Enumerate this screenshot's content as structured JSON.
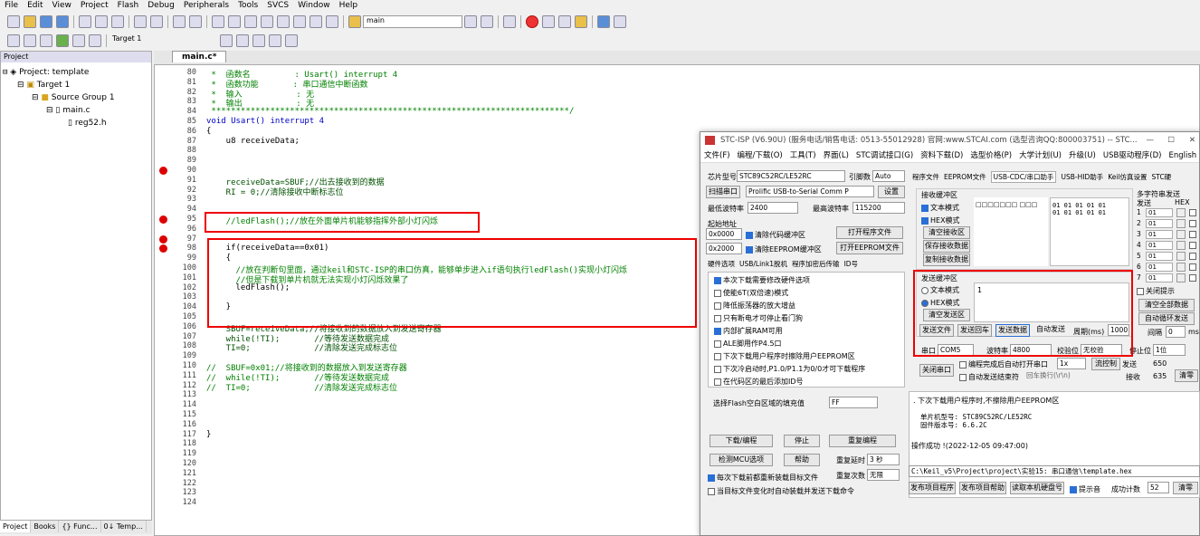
{
  "menu": [
    "File",
    "Edit",
    "View",
    "Project",
    "Flash",
    "Debug",
    "Peripherals",
    "Tools",
    "SVCS",
    "Window",
    "Help"
  ],
  "toolbar": {
    "target_search": "main",
    "target": "Target 1"
  },
  "project": {
    "header": "Project",
    "root": "Project: template",
    "target": "Target 1",
    "group": "Source Group 1",
    "file1": "main.c",
    "file2": "reg52.h",
    "tabs": [
      "Project",
      "Books",
      "{} Func...",
      "0↓ Temp..."
    ]
  },
  "editor": {
    "tab": "main.c*"
  },
  "code_lines": [
    {
      "n": "80",
      "t": " *  函数名         : Usart() interrupt 4",
      "c": "cm"
    },
    {
      "n": "81",
      "t": " *  函数功能       : 串口通信中断函数",
      "c": "cm"
    },
    {
      "n": "82",
      "t": " *  输入           : 无",
      "c": "cm"
    },
    {
      "n": "83",
      "t": " *  输出           : 无",
      "c": "cm"
    },
    {
      "n": "84",
      "t": " *************************************************************************/",
      "c": "cm"
    },
    {
      "n": "85",
      "t": "void Usart() interrupt 4",
      "c": "kw"
    },
    {
      "n": "86",
      "t": "{",
      "c": ""
    },
    {
      "n": "87",
      "t": "    u8 receiveData;",
      "c": ""
    },
    {
      "n": "88",
      "t": "",
      "c": ""
    },
    {
      "n": "89",
      "t": "",
      "c": ""
    },
    {
      "n": "90",
      "t": "",
      "c": ""
    },
    {
      "n": "91",
      "t": "    receiveData=SBUF;//出去接收到的数据",
      "c": "mix"
    },
    {
      "n": "92",
      "t": "    RI = 0;//清除接收中断标志位",
      "c": "mix"
    },
    {
      "n": "93",
      "t": "",
      "c": ""
    },
    {
      "n": "94",
      "t": "",
      "c": ""
    },
    {
      "n": "95",
      "t": "    //ledFlash();//放在外面单片机能够指挥外部小灯闪烁",
      "c": "cm"
    },
    {
      "n": "96",
      "t": "",
      "c": ""
    },
    {
      "n": "97",
      "t": "",
      "c": ""
    },
    {
      "n": "98",
      "t": "    if(receiveData==0x01)",
      "c": ""
    },
    {
      "n": "99",
      "t": "    {",
      "c": ""
    },
    {
      "n": "100",
      "t": "      //放在判断句里面，通过keil和STC-ISP的串口仿真，能够单步进入if语句执行ledFlash()实现小灯闪烁",
      "c": "cm"
    },
    {
      "n": "101",
      "t": "      //但是下载到单片机就无法实现小灯闪烁效果了",
      "c": "cm"
    },
    {
      "n": "102",
      "t": "      ledFlash();",
      "c": ""
    },
    {
      "n": "103",
      "t": "",
      "c": ""
    },
    {
      "n": "104",
      "t": "    }",
      "c": ""
    },
    {
      "n": "105",
      "t": "",
      "c": ""
    },
    {
      "n": "106",
      "t": "    SBUF=receiveData;//将接收到的数据放入到发送寄存器",
      "c": "mix"
    },
    {
      "n": "107",
      "t": "    while(!TI);       //等待发送数据完成",
      "c": "mix"
    },
    {
      "n": "108",
      "t": "    TI=0;             //清除发送完成标志位",
      "c": "mix"
    },
    {
      "n": "109",
      "t": "",
      "c": ""
    },
    {
      "n": "110",
      "t": "//  SBUF=0x01;//将接收到的数据放入到发送寄存器",
      "c": "cm"
    },
    {
      "n": "111",
      "t": "//  while(!TI);       //等待发送数据完成",
      "c": "cm"
    },
    {
      "n": "112",
      "t": "//  TI=0;             //清除发送完成标志位",
      "c": "cm"
    },
    {
      "n": "113",
      "t": "",
      "c": ""
    },
    {
      "n": "114",
      "t": "",
      "c": ""
    },
    {
      "n": "115",
      "t": "",
      "c": ""
    },
    {
      "n": "116",
      "t": "",
      "c": ""
    },
    {
      "n": "117",
      "t": "}",
      "c": ""
    },
    {
      "n": "118",
      "t": "",
      "c": ""
    },
    {
      "n": "119",
      "t": "",
      "c": ""
    },
    {
      "n": "120",
      "t": "",
      "c": ""
    },
    {
      "n": "121",
      "t": "",
      "c": ""
    },
    {
      "n": "122",
      "t": "",
      "c": ""
    },
    {
      "n": "123",
      "t": "",
      "c": ""
    },
    {
      "n": "124",
      "t": "",
      "c": ""
    }
  ],
  "stc": {
    "title": "STC-ISP (V6.90U) (服务电话/销售电话: 0513-55012928) 官网:www.STCAI.com  (选型咨询QQ:800003751) -- STC...",
    "menu": [
      "文件(F)",
      "编程/下载(O)",
      "工具(T)",
      "界面(L)",
      "STC调试接口(G)",
      "资料下载(D)",
      "选型价格(P)",
      "大学计划(U)",
      "升级(U)",
      "USB驱动程序(D)",
      "English"
    ],
    "chip_label": "芯片型号",
    "chip": "STC89C52RC/LE52RC",
    "pins_label": "引脚数",
    "pins": "Auto",
    "scan": "扫描串口",
    "port": "Prolific USB-to-Serial Comm P",
    "settings": "设置",
    "minbaud_label": "最低波特率",
    "minbaud": "2400",
    "maxbaud_label": "最高波特率",
    "maxbaud": "115200",
    "start_addr": "起始地址",
    "addr1": "0x0000",
    "clear_code": "清除代码缓冲区",
    "open_prog": "打开程序文件",
    "addr2": "0x2000",
    "clear_eeprom": "清除EEPROM缓冲区",
    "open_eeprom": "打开EEPROM文件",
    "hwtabs": [
      "硬件选项",
      "USB/Link1脱机",
      "程序加密后传输",
      "ID号"
    ],
    "options": [
      {
        "t": "本次下载需要修改硬件选项",
        "on": true
      },
      {
        "t": "使能6T(双倍速)模式",
        "on": false
      },
      {
        "t": "降低振荡器的放大增益",
        "on": false
      },
      {
        "t": "只有断电才可停止看门狗",
        "on": false
      },
      {
        "t": "内部扩展RAM可用",
        "on": true
      },
      {
        "t": "ALE脚用作P4.5口",
        "on": false
      },
      {
        "t": "下次下载用户程序时擦除用户EEPROM区",
        "on": false
      },
      {
        "t": "下次冷启动时,P1.0/P1.1为0/0才可下载程序",
        "on": false
      },
      {
        "t": "在代码区的最后添加ID号",
        "on": false
      }
    ],
    "fill_label": "选择Flash空白区域的填充值",
    "fill": "FF",
    "download": "下载/编程",
    "stop": "停止",
    "reprog": "重复编程",
    "check_mcu": "检测MCU选项",
    "help": "帮助",
    "repeat_delay": "重复延时",
    "repeat_delay_val": "3 秒",
    "reload": "每次下载前都重新装载目标文件",
    "repeat_count": "重复次数",
    "repeat_count_val": "无限",
    "auto_send": "当目标文件变化时自动装载并发送下载命令",
    "rtabs": [
      "程序文件",
      "EEPROM文件",
      "USB-CDC/串口助手",
      "USB-HID助手",
      "Keil仿真设置",
      "STC硬"
    ],
    "recv_title": "接收缓冲区",
    "text_mode": "文本模式",
    "hex_mode": "HEX模式",
    "clear_recv": "清空接收区",
    "save_recv": "保存接收数据",
    "copy_recv": "复制接收数据",
    "recv_glyph": "□□□□□□□ □□□",
    "recv_hex1": "01 01 01 01 01",
    "recv_hex2": "01 01 01 01 01",
    "multi_title": "多字符串发送",
    "multi_send": "发送",
    "multi_hex": "HEX",
    "multi_rows": [
      "1",
      "2",
      "3",
      "4",
      "5",
      "6",
      "7"
    ],
    "multi_val": "01",
    "close_tip": "关闭提示",
    "clear_all": "清空全部数据",
    "auto_loop": "自动循环发送",
    "interval_label": "间隔",
    "interval": "0",
    "interval_unit": "ms",
    "send_title": "发送缓冲区",
    "send_text": "文本模式",
    "send_hex": "HEX模式",
    "clear_send": "清空发送区",
    "send_value": "1",
    "send_file": "发送文件",
    "send_enter": "发送回车",
    "send_data": "发送数据",
    "auto_send_btn": "自动发送",
    "period": "周期(ms)",
    "period_val": "1000",
    "port_label": "串口",
    "port_val": "COM5",
    "baud_label": "波特率",
    "baud_val": "4800",
    "parity_label": "校验位",
    "parity_val": "无校验",
    "stop_label": "停止位",
    "stop_val": "1位",
    "close_port": "关闭串口",
    "auto_open": "编程完成后自动打开串口",
    "auto_open_val": "1x",
    "flow": "流控制",
    "sent_label": "发送",
    "sent_val": "650",
    "auto_send_end": "自动发送结束符",
    "end_val": "回车换行(\\r\\n)",
    "recv_label": "接收",
    "recv_val": "635",
    "clear_cnt": "清零",
    "log1": ". 下次下载用户程序时,不擦除用户EEPROM区",
    "log2": "单片机型号:  STC89C52RC/LE52RC",
    "log3": "固件版本号:  6.6.2C",
    "log4": "操作成功 !(2022-12-05 09:47:00)",
    "path": "C:\\Keil_v5\\Project\\project\\实验15: 串口通信\\template.hex",
    "pub_prog": "发布项目程序",
    "pub_help": "发布项目帮助",
    "read_sn": "读取本机硬盘号",
    "tip_sound": "提示音",
    "success_label": "成功计数",
    "success_val": "52",
    "clear2": "清零"
  }
}
